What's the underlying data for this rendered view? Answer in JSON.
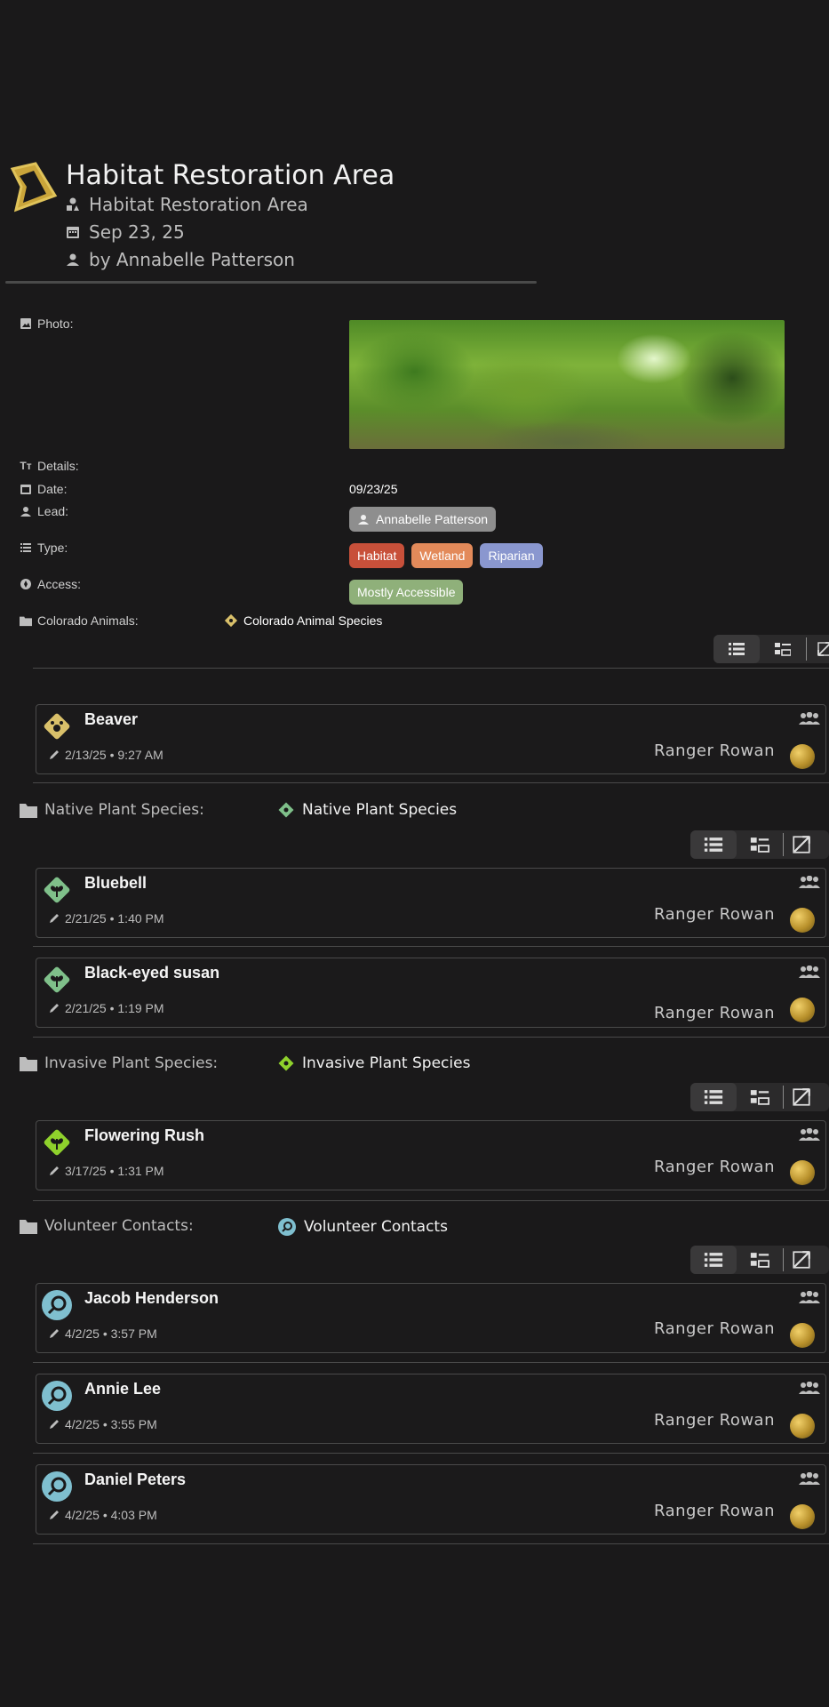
{
  "header": {
    "title": "Habitat Restoration Area",
    "category": "Habitat Restoration Area",
    "date": "Sep 23, 25",
    "author": "by Annabelle Patterson"
  },
  "fields": {
    "photo_label": "Photo:",
    "details_label": "Details:",
    "date_label": "Date:",
    "date_value": "09/23/25",
    "lead_label": "Lead:",
    "lead_value": "Annabelle Patterson",
    "type_label": "Type:",
    "types": [
      {
        "label": "Habitat",
        "color": "#c8503a"
      },
      {
        "label": "Wetland",
        "color": "#e38a5a"
      },
      {
        "label": "Riparian",
        "color": "#8a97cf"
      }
    ],
    "access_label": "Access:",
    "access_value": "Mostly Accessible",
    "access_color": "#8fb07a"
  },
  "sections": {
    "animals": {
      "label": "Colorado Animals:",
      "link": "Colorado Animal Species",
      "items": [
        {
          "name": "Beaver",
          "edited": "2/13/25 • 9:27 AM",
          "owner": "Ranger Rowan"
        }
      ]
    },
    "native": {
      "label": "Native Plant Species:",
      "link": "Native Plant Species",
      "items": [
        {
          "name": "Bluebell",
          "edited": "2/21/25 • 1:40 PM",
          "owner": "Ranger Rowan"
        },
        {
          "name": "Black-eyed susan",
          "edited": "2/21/25 • 1:19 PM",
          "owner": "Ranger Rowan"
        }
      ]
    },
    "invasive": {
      "label": "Invasive Plant Species:",
      "link": "Invasive Plant Species",
      "items": [
        {
          "name": "Flowering Rush",
          "edited": "3/17/25 • 1:31 PM",
          "owner": "Ranger Rowan"
        }
      ]
    },
    "volunteers": {
      "label": "Volunteer Contacts:",
      "link": "Volunteer Contacts",
      "items": [
        {
          "name": "Jacob Henderson",
          "edited": "4/2/25 • 3:57 PM",
          "owner": "Ranger Rowan"
        },
        {
          "name": "Annie Lee",
          "edited": "4/2/25 • 3:55 PM",
          "owner": "Ranger Rowan"
        },
        {
          "name": "Daniel Peters",
          "edited": "4/2/25 • 4:03 PM",
          "owner": "Ranger Rowan"
        }
      ]
    }
  },
  "colors": {
    "animal_icon": "#d9c06a",
    "native_icon": "#7fc08a",
    "invasive_icon": "#8fd12c",
    "volunteer_icon": "#7fbfcf"
  }
}
